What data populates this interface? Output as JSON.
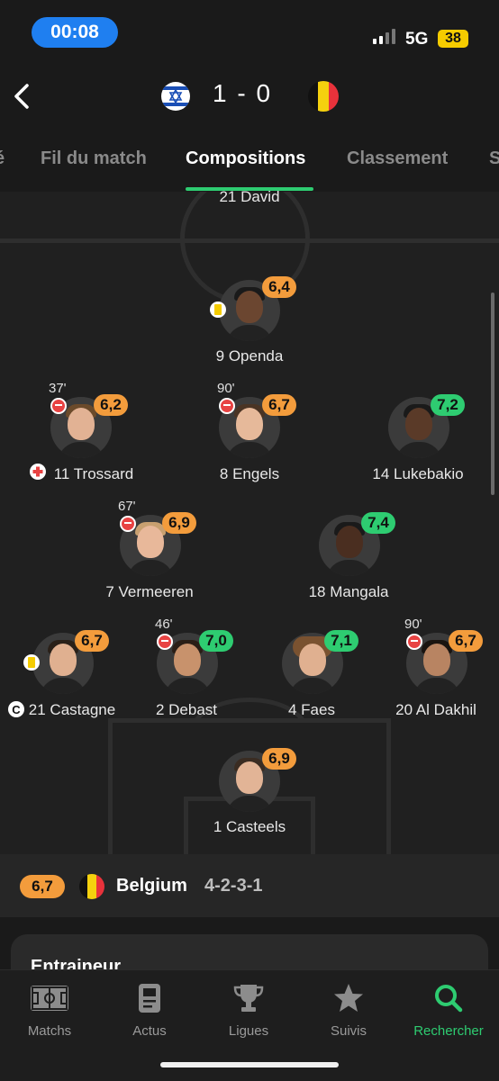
{
  "status_bar": {
    "time": "00:08",
    "network": "5G",
    "battery": "38"
  },
  "header": {
    "score": "1 - 0",
    "home_team_flag": "israel-flag-icon",
    "away_team_flag": "belgium-flag-icon"
  },
  "tabs": [
    "é",
    "Fil du match",
    "Compositions",
    "Classement",
    "S"
  ],
  "active_tab": "Compositions",
  "opponent_partial": "21 David",
  "players": [
    {
      "name": "9 Openda",
      "rating": "6,4",
      "color": "orange",
      "yellow_card": true
    },
    {
      "name": "11 Trossard",
      "rating": "6,2",
      "color": "orange",
      "sub_minute": "37'",
      "injury": true
    },
    {
      "name": "8 Engels",
      "rating": "6,7",
      "color": "orange",
      "sub_minute": "90'"
    },
    {
      "name": "14 Lukebakio",
      "rating": "7,2",
      "color": "green"
    },
    {
      "name": "7 Vermeeren",
      "rating": "6,9",
      "color": "orange",
      "sub_minute": "67'"
    },
    {
      "name": "18 Mangala",
      "rating": "7,4",
      "color": "green"
    },
    {
      "name": "21 Castagne",
      "rating": "6,7",
      "color": "orange",
      "yellow_card": true,
      "captain": "C"
    },
    {
      "name": "2 Debast",
      "rating": "7,0",
      "color": "green",
      "sub_minute": "46'"
    },
    {
      "name": "4 Faes",
      "rating": "7,1",
      "color": "green"
    },
    {
      "name": "20 Al Dakhil",
      "rating": "6,7",
      "color": "orange",
      "sub_minute": "90'"
    },
    {
      "name": "1 Casteels",
      "rating": "6,9",
      "color": "orange"
    }
  ],
  "team_bar": {
    "rating": "6,7",
    "team": "Belgium",
    "formation": "4-2-3-1"
  },
  "coach_card": {
    "title": "Entraineur"
  },
  "nav": [
    {
      "label": "Matchs",
      "icon": "pitch-icon"
    },
    {
      "label": "Actus",
      "icon": "news-icon"
    },
    {
      "label": "Ligues",
      "icon": "trophy-icon"
    },
    {
      "label": "Suivis",
      "icon": "star-icon"
    },
    {
      "label": "Rechercher",
      "icon": "search-icon"
    }
  ],
  "colors": {
    "accent": "#2ecc71",
    "rating_orange": "#f39c3c",
    "rating_green": "#2ecc71",
    "time_pill": "#1f7ff0",
    "sub_icon": "#e84343"
  }
}
